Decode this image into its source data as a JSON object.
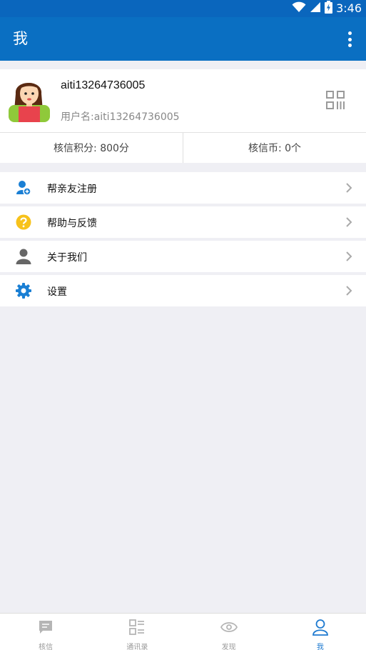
{
  "status_bar": {
    "time": "3:46"
  },
  "app_bar": {
    "title": "我"
  },
  "profile": {
    "name": "aiti13264736005",
    "username_line": "用户名:aiti13264736005"
  },
  "stats": {
    "points": "核信积分: 800分",
    "coins": "核信币: 0个"
  },
  "menu": {
    "items": [
      {
        "label": "帮亲友注册",
        "icon": "add-friend-icon"
      },
      {
        "label": "帮助与反馈",
        "icon": "help-icon"
      },
      {
        "label": "关于我们",
        "icon": "person-icon"
      },
      {
        "label": "设置",
        "icon": "gear-icon"
      }
    ]
  },
  "tabs": [
    {
      "label": "核信",
      "icon": "chat-icon"
    },
    {
      "label": "通讯录",
      "icon": "contacts-icon"
    },
    {
      "label": "发现",
      "icon": "eye-icon"
    },
    {
      "label": "我",
      "icon": "user-icon",
      "active": true
    }
  ],
  "colors": {
    "primary": "#0a6fc2",
    "background": "#efeff4",
    "active_tab": "#1e7ad0"
  }
}
